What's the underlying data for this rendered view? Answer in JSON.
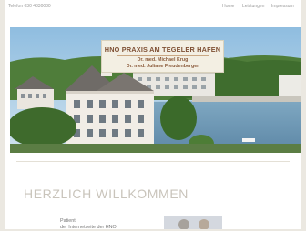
{
  "topbar": {
    "phone": "Telefon 030 4330080",
    "nav": [
      "Home",
      "Leistungen",
      "Impressum"
    ]
  },
  "logo": {
    "title": "HNO PRAXIS AM TEGELER HAFEN",
    "doctors": [
      "Dr. med. Michael Krug",
      "Dr. med. Juliane Freudenberger"
    ]
  },
  "welcome": {
    "heading": "HERZLICH WILLKOMMEN",
    "text_lines": [
      "Patient,",
      "der Internetseite der HNO"
    ]
  },
  "colors": {
    "logo_text": "#7e4f33",
    "heading": "#c9c4bb",
    "background": "#ebe8e1"
  }
}
